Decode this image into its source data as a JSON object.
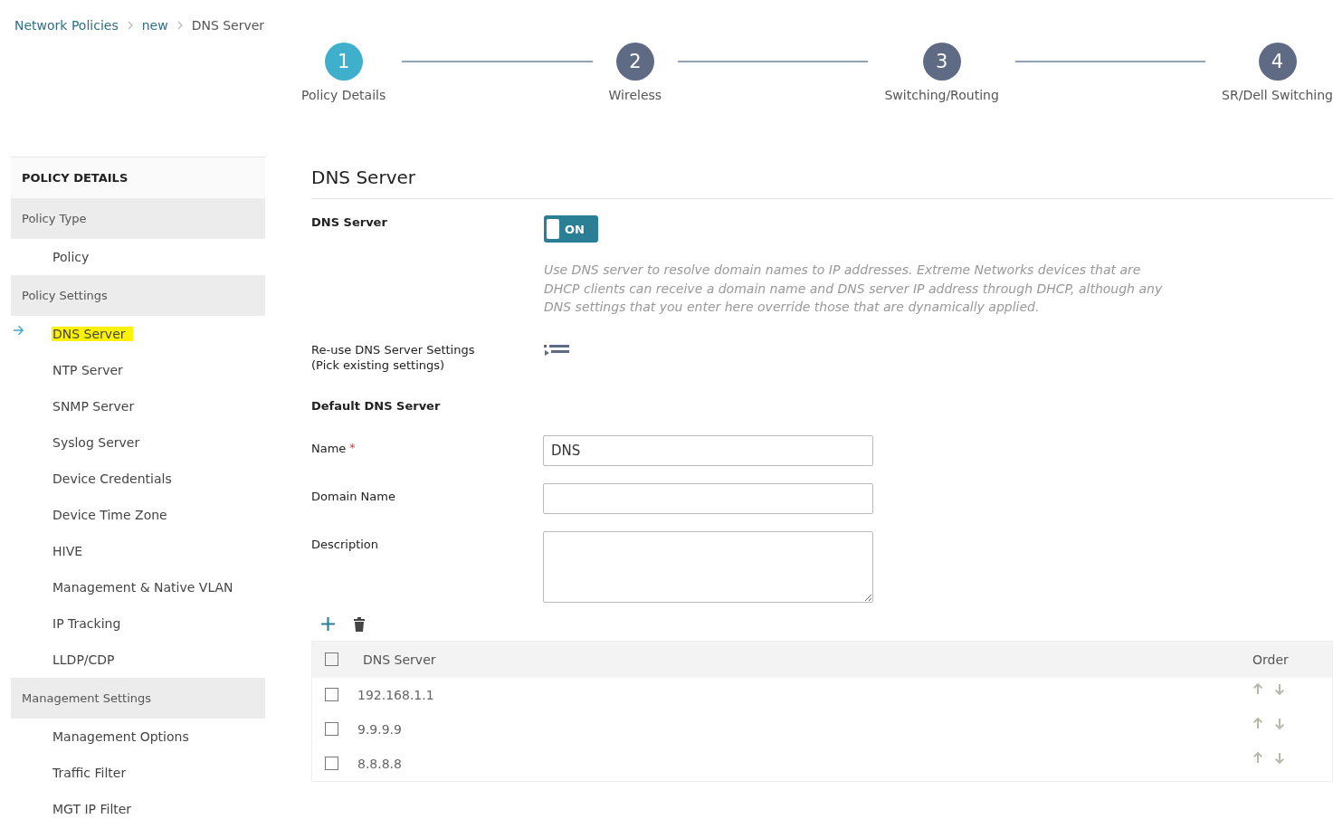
{
  "breadcrumb": [
    {
      "label": "Network Policies",
      "kind": "link"
    },
    {
      "label": "new",
      "kind": "link"
    },
    {
      "label": "DNS Server",
      "kind": "current"
    }
  ],
  "steps": [
    {
      "number": "1",
      "label": "Policy Details",
      "selected": true
    },
    {
      "number": "2",
      "label": "Wireless",
      "selected": false
    },
    {
      "number": "3",
      "label": "Switching/Routing",
      "selected": false
    },
    {
      "number": "4",
      "label": "SR/Dell Switching",
      "selected": false
    }
  ],
  "sidebar": {
    "items": [
      {
        "kind": "header",
        "label": "POLICY DETAILS"
      },
      {
        "kind": "group",
        "label": "Policy Type"
      },
      {
        "kind": "item",
        "label": "Policy",
        "selected": false
      },
      {
        "kind": "group",
        "label": "Policy Settings"
      },
      {
        "kind": "item",
        "label": "DNS Server",
        "selected": true
      },
      {
        "kind": "item",
        "label": "NTP Server",
        "selected": false
      },
      {
        "kind": "item",
        "label": "SNMP Server",
        "selected": false
      },
      {
        "kind": "item",
        "label": "Syslog Server",
        "selected": false
      },
      {
        "kind": "item",
        "label": "Device Credentials",
        "selected": false
      },
      {
        "kind": "item",
        "label": "Device Time Zone",
        "selected": false
      },
      {
        "kind": "item",
        "label": "HIVE",
        "selected": false
      },
      {
        "kind": "item",
        "label": "Management & Native VLAN",
        "selected": false
      },
      {
        "kind": "item",
        "label": "IP Tracking",
        "selected": false
      },
      {
        "kind": "item",
        "label": "LLDP/CDP",
        "selected": false
      },
      {
        "kind": "group",
        "label": "Management Settings"
      },
      {
        "kind": "item",
        "label": "Management Options",
        "selected": false
      },
      {
        "kind": "item",
        "label": "Traffic Filter",
        "selected": false
      },
      {
        "kind": "item",
        "label": "MGT IP Filter",
        "selected": false
      }
    ]
  },
  "main": {
    "title": "DNS Server",
    "toggle": {
      "label": "DNS Server",
      "on": true,
      "text": "ON"
    },
    "description": "Use DNS server to resolve domain names to IP addresses. Extreme Networks devices that are DHCP clients can receive a domain name and DNS server IP address through DHCP, although any DNS settings that you enter here override those that are dynamically applied.",
    "reuse": {
      "label": "Re-use DNS Server Settings",
      "sublabel": "(Pick existing settings)"
    },
    "section_title": "Default DNS Server",
    "fields": [
      {
        "label": "Name",
        "required": true,
        "value": "DNS",
        "kind": "input"
      },
      {
        "label": "Domain Name",
        "required": false,
        "kind": "input"
      },
      {
        "label": "Description",
        "required": false,
        "kind": "textarea"
      }
    ],
    "required_mark": "*",
    "table": {
      "columns": [
        "DNS Server",
        "Order"
      ],
      "header_checked": false,
      "rows": [
        {
          "server": "192.168.1.1",
          "checked": false
        },
        {
          "server": "9.9.9.9",
          "checked": false
        },
        {
          "server": "8.8.8.8",
          "checked": false
        }
      ]
    }
  }
}
